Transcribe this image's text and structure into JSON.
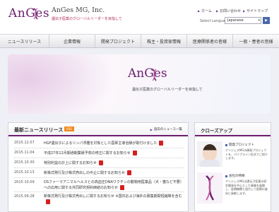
{
  "header": {
    "logo_text": "AnGes",
    "company_name": "AnGes MG, Inc.",
    "tagline": "遺伝子医薬のグローバルリーダーを目指して",
    "util_links": [
      "ホーム",
      "お問い合わせ",
      "サイトマップ"
    ],
    "language_label": "Select Language",
    "language_value": "Japanese",
    "language_go": "▶"
  },
  "nav": {
    "items": [
      "ニュースリリース",
      "企業情報",
      "開発プロジェクト",
      "株主・投資家情報",
      "医療関係者の皆様",
      "一般・患者の皆様"
    ]
  },
  "hero": {
    "logo_text": "AnGes",
    "tagline": "遺伝子医薬のグローバルリーダーを目指して"
  },
  "news": {
    "title": "最新ニュースリリース",
    "rss_label": "RSS",
    "more_label": "過去のニュース一覧",
    "items": [
      {
        "date": "2015.12.07",
        "text": "HGF遺伝子によるリンパ浮腫を対象とした医師主導治験が取付けました"
      },
      {
        "date": "2015.11.04",
        "text": "平成27年12月期通期業績予想の修正に関するお知らせ"
      },
      {
        "date": "2015.10.30",
        "text": "特別利益の計上に関するお知らせ"
      },
      {
        "date": "2015.10.13",
        "text": "新株式発行及び株式売出しの中止に関するお知らせ"
      },
      {
        "date": "2015.10.09",
        "text": "DSファーマアニマルヘルスとの高血圧DNAワクチンの動物用医薬品（犬・猫など不要）への応用に関する共同研究契約締結のお知らせ"
      },
      {
        "date": "2015.09.28",
        "text": "新株式発行及び株式売出しに関するお知らせ ※国内および海外の募集期間短縮等を含む"
      }
    ]
  },
  "closeup": {
    "title": "クローズアップ",
    "cards": [
      {
        "label": "開発プロジェクト",
        "text": "アンジェスMGの開発プロジェクトを、パイプライン形式でご紹介します。"
      },
      {
        "label": "会社の特徴",
        "text": "アンジェスMGは遺伝子医薬の研究開発を中心とした事業を展開し、医療機関と協力して医療の進歩に貢献します。"
      }
    ]
  },
  "colors": {
    "brand": "#6c1d6f",
    "accent": "#4a68a8",
    "rss": "#f08a1c",
    "pdf": "#d42020"
  }
}
